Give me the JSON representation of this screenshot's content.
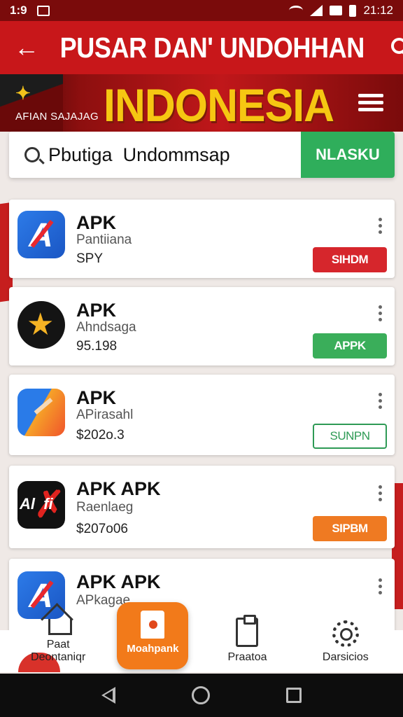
{
  "status_bar": {
    "time": "1:9",
    "clock": "21:12"
  },
  "app_bar": {
    "title": "PUSAR DAN' UNDOHHAN"
  },
  "banner": {
    "title": "INDONESIA",
    "subtitle": "AFIAN SAJAJAG"
  },
  "search": {
    "placeholder": "Pbutiga  Undommsap",
    "button_label": "NLASKU"
  },
  "apps": [
    {
      "name": "APK",
      "subtitle": "Pantiiana",
      "price": "SPY",
      "button_label": "SIHDM",
      "button_color": "#d6262c"
    },
    {
      "name": "APK",
      "subtitle": "Ahndsaga",
      "price": "95.198",
      "button_label": "APPK",
      "button_color": "#3aae5a"
    },
    {
      "name": "APK",
      "subtitle": "APirasahl",
      "price": "$202o.3",
      "button_label": "SUNPN",
      "button_color": "#2e9a55"
    },
    {
      "name": "APK APK",
      "subtitle": "Raenlaeg",
      "price": "$207o06",
      "button_label": "SIPBM",
      "button_color": "#ef7a22"
    },
    {
      "name": "APK APK",
      "subtitle": "APkagae",
      "price": ""
    }
  ],
  "nav": [
    {
      "label": "Paat",
      "label2": "Deontaniqr"
    },
    {
      "label": "Moahpank"
    },
    {
      "label": "Praatoa"
    },
    {
      "label": "Darsicios"
    }
  ]
}
